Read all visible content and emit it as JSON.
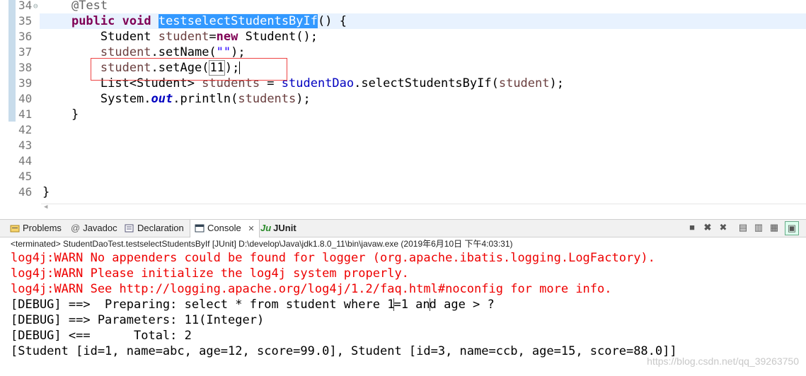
{
  "editor": {
    "lines": [
      {
        "num": "34",
        "parts": [
          {
            "t": "    ",
            "c": ""
          },
          {
            "t": "@Test",
            "c": "ann"
          }
        ]
      },
      {
        "num": "35",
        "parts": [
          {
            "t": "    ",
            "c": ""
          },
          {
            "t": "public",
            "c": "kw"
          },
          {
            "t": " ",
            "c": ""
          },
          {
            "t": "void",
            "c": "kw"
          },
          {
            "t": " ",
            "c": ""
          },
          {
            "t": "testselectStudentsByIf",
            "c": "sel"
          },
          {
            "t": "() {",
            "c": ""
          }
        ]
      },
      {
        "num": "36",
        "parts": [
          {
            "t": "        Student ",
            "c": ""
          },
          {
            "t": "student",
            "c": "var"
          },
          {
            "t": "=",
            "c": ""
          },
          {
            "t": "new",
            "c": "kw"
          },
          {
            "t": " Student();",
            "c": ""
          }
        ]
      },
      {
        "num": "37",
        "parts": [
          {
            "t": "        ",
            "c": ""
          },
          {
            "t": "student",
            "c": "var"
          },
          {
            "t": ".setName(",
            "c": ""
          },
          {
            "t": "\"\"",
            "c": "str"
          },
          {
            "t": ");",
            "c": ""
          }
        ]
      },
      {
        "num": "38",
        "parts": [
          {
            "t": "        ",
            "c": ""
          },
          {
            "t": "student",
            "c": "var"
          },
          {
            "t": ".setAge(",
            "c": ""
          },
          {
            "t": "11",
            "c": "numbox"
          },
          {
            "t": ");",
            "c": ""
          },
          {
            "t": "",
            "c": "caret"
          }
        ]
      },
      {
        "num": "39",
        "parts": [
          {
            "t": "        List<Student> ",
            "c": ""
          },
          {
            "t": "students",
            "c": "var"
          },
          {
            "t": " = ",
            "c": ""
          },
          {
            "t": "studentDao",
            "c": "fld"
          },
          {
            "t": ".selectStudentsByIf(",
            "c": ""
          },
          {
            "t": "student",
            "c": "var"
          },
          {
            "t": ");",
            "c": ""
          }
        ]
      },
      {
        "num": "40",
        "parts": [
          {
            "t": "        System.",
            "c": ""
          },
          {
            "t": "out",
            "c": "sfld"
          },
          {
            "t": ".println(",
            "c": ""
          },
          {
            "t": "students",
            "c": "var"
          },
          {
            "t": ");",
            "c": ""
          }
        ]
      },
      {
        "num": "41",
        "parts": [
          {
            "t": "    }",
            "c": ""
          }
        ]
      },
      {
        "num": "42",
        "parts": []
      },
      {
        "num": "43",
        "parts": []
      },
      {
        "num": "44",
        "parts": []
      },
      {
        "num": "45",
        "parts": []
      },
      {
        "num": "46",
        "parts": [
          {
            "t": "}",
            "c": ""
          }
        ]
      }
    ]
  },
  "tabs": {
    "problems": "Problems",
    "javadoc": "Javadoc",
    "declaration": "Declaration",
    "console": "Console",
    "console_close": "✕",
    "junit": "JUnit"
  },
  "console": {
    "status": "<terminated> StudentDaoTest.testselectStudentsByIf [JUnit] D:\\develop\\Java\\jdk1.8.0_11\\bin\\javaw.exe (2019年6月10日 下午4:03:31)",
    "warn1": "log4j:WARN No appenders could be found for logger (org.apache.ibatis.logging.LogFactory).",
    "warn2": "log4j:WARN Please initialize the log4j system properly.",
    "warn3": "log4j:WARN See http://logging.apache.org/log4j/1.2/faq.html#noconfig for more info.",
    "debug1_a": "[DEBUG] ==>  Preparing: select * from student where 1",
    "debug1_b": "=1 an",
    "debug1_c": "d age > ?",
    "debug2": "[DEBUG] ==> Parameters: 11(Integer)",
    "debug3": "[DEBUG] <==      Total: 2",
    "result": "[Student [id=1, name=abc, age=12, score=99.0], Student [id=3, name=ccb, age=15, score=88.0]]"
  },
  "watermark": "https://blog.csdn.net/qq_39263750"
}
